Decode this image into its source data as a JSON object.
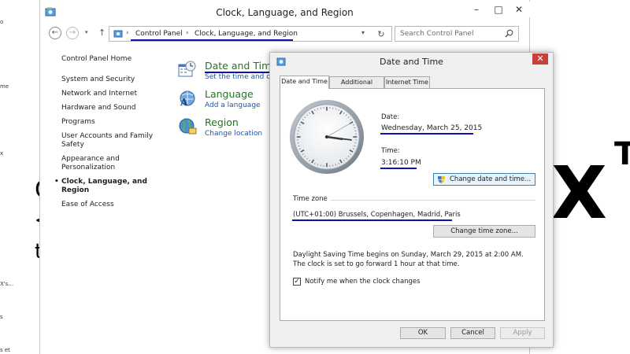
{
  "desktop": {
    "left_fragments": [
      "o",
      "me",
      "x",
      "X's...",
      "s",
      "s et"
    ],
    "bg_glyphs": [
      "C",
      "<",
      "t"
    ],
    "bg_x": "X",
    "bg_t": "T"
  },
  "control_panel": {
    "title": "Clock, Language, and Region",
    "window_controls": {
      "minimize": "–",
      "maximize": "□",
      "close": "✕"
    },
    "nav": {
      "back": "←",
      "forward": "→",
      "recent": "▾",
      "up": "↑",
      "breadcrumb": [
        "Control Panel",
        "Clock, Language, and Region"
      ],
      "separator": "›",
      "dropdown": "▾",
      "refresh": "↻",
      "search_placeholder": "Search Control Panel"
    },
    "left_nav": {
      "home": "Control Panel Home",
      "items": [
        "System and Security",
        "Network and Internet",
        "Hardware and Sound",
        "Programs",
        "User Accounts and Family Safety",
        "Appearance and Personalization",
        "Clock, Language, and Region",
        "Ease of Access"
      ],
      "current_index": 6
    },
    "categories": {
      "date_time": {
        "title": "Date and Time",
        "link": "Set the time and date"
      },
      "language": {
        "title": "Language",
        "link": "Add a language"
      },
      "region": {
        "title": "Region",
        "link": "Change location"
      }
    }
  },
  "dialog": {
    "title": "Date and Time",
    "close": "✕",
    "tabs": [
      "Date and Time",
      "Additional Clocks",
      "Internet Time"
    ],
    "active_tab": 0,
    "date_label": "Date:",
    "date_value": "Wednesday, March 25, 2015",
    "time_label": "Time:",
    "time_value": "3:16:10 PM",
    "clock": {
      "hour": 3,
      "minute": 16,
      "second": 10
    },
    "change_datetime_button": "Change date and time...",
    "time_zone_label": "Time zone",
    "time_zone_value": "(UTC+01:00) Brussels, Copenhagen, Madrid, Paris",
    "change_timezone_button": "Change time zone...",
    "dst_text": "Daylight Saving Time begins on Sunday, March 29, 2015 at 2:00 AM. The clock is set to go forward 1 hour at that time.",
    "notify_checked": true,
    "notify_label": "Notify me when the clock changes",
    "buttons": {
      "ok": "OK",
      "cancel": "Cancel",
      "apply": "Apply"
    }
  },
  "colors": {
    "highlight_underline": "#1010b0",
    "category_title": "#1e7a1e",
    "link": "#1b57b3",
    "dialog_close": "#c7403a"
  }
}
